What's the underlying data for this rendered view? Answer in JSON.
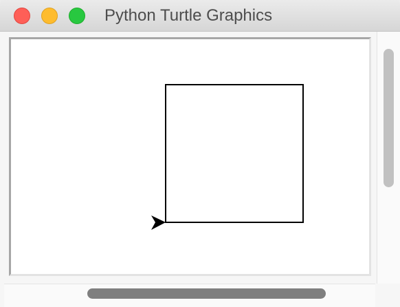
{
  "window": {
    "title": "Python Turtle Graphics",
    "buttons": {
      "close_color": "#fe5f57",
      "minimize_color": "#febc2e",
      "zoom_color": "#28c840"
    }
  },
  "canvas": {
    "background": "#ffffff",
    "drawing": {
      "shape": "square",
      "stroke_color": "#000000",
      "turtle_icon": "arrow-cursor-icon",
      "turtle_heading": "east"
    }
  },
  "scrollbars": {
    "vertical": {
      "visible": true
    },
    "horizontal": {
      "visible": true
    }
  }
}
